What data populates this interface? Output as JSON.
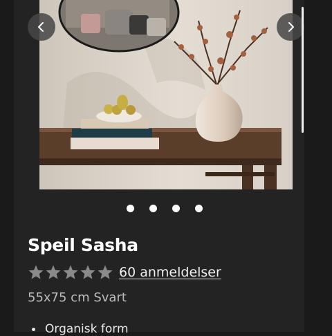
{
  "gallery": {
    "prev_icon": "chevron-left-icon",
    "next_icon": "chevron-right-icon",
    "slide_count": 4
  },
  "product": {
    "title": "Speil Sasha",
    "rating": 5,
    "rating_max": 5,
    "reviews_label": "60 anmeldelser",
    "variant": "55x75 cm Svart",
    "features": [
      "Organisk form"
    ]
  },
  "colors": {
    "background": "#1a1a1a",
    "panel": "#232323",
    "star": "#8a8a8a"
  }
}
